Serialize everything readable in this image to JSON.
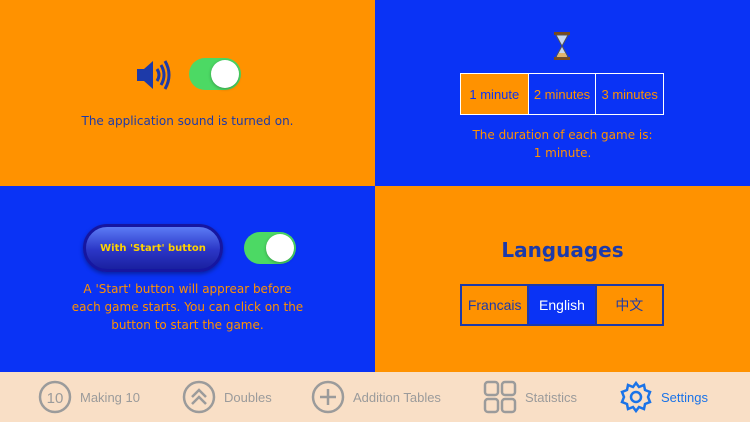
{
  "sound": {
    "icon": "speaker-icon",
    "enabled": true,
    "status_text": "The application sound is turned on."
  },
  "duration": {
    "icon": "hourglass-icon",
    "options": [
      "1 minute",
      "2 minutes",
      "3 minutes"
    ],
    "selected": "1 minute",
    "text_line1": "The duration of each game is:",
    "text_line2": "1 minute."
  },
  "start_button": {
    "label": "With 'Start' button",
    "enabled": true,
    "text_line1": "A 'Start' button will apprear before",
    "text_line2": "each game starts. You can click on the",
    "text_line3": "button to start the game."
  },
  "languages": {
    "title": "Languages",
    "options": [
      "Francais",
      "English",
      "中文"
    ],
    "selected": "English"
  },
  "tabbar": {
    "items": [
      {
        "label": "Making 10",
        "icon": "ten-circle-icon"
      },
      {
        "label": "Doubles",
        "icon": "double-chevron-up-icon"
      },
      {
        "label": "Addition Tables",
        "icon": "plus-circle-icon"
      },
      {
        "label": "Statistics",
        "icon": "grid-icon"
      },
      {
        "label": "Settings",
        "icon": "gear-icon"
      }
    ],
    "active": "Settings",
    "ten_glyph": "10"
  },
  "colors": {
    "orange": "#ff9200",
    "blue": "#0a33f5",
    "toggle_on": "#4cd964",
    "tab_active": "#1a73e8",
    "tabbar_bg": "#f9dfc6"
  }
}
